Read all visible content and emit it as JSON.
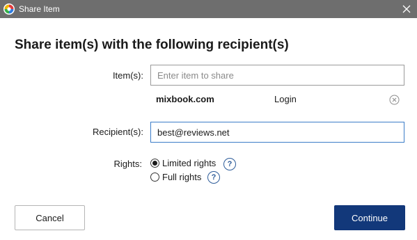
{
  "window": {
    "title": "Share Item",
    "icon": "app-logo-icon",
    "close_icon": "close-icon"
  },
  "heading": "Share item(s) with the following recipient(s)",
  "items_field": {
    "label": "Item(s):",
    "placeholder": "Enter item to share",
    "value": ""
  },
  "selected_item": {
    "name": "mixbook.com",
    "type": "Login",
    "remove_icon": "remove-circle-x-icon"
  },
  "recipients_field": {
    "label": "Recipient(s):",
    "value": "best@reviews.net"
  },
  "rights": {
    "label": "Rights:",
    "options": [
      {
        "label": "Limited rights",
        "selected": true,
        "help_icon": "help-icon"
      },
      {
        "label": "Full rights",
        "selected": false,
        "help_icon": "help-icon"
      }
    ],
    "help_glyph": "?"
  },
  "buttons": {
    "cancel": "Cancel",
    "continue": "Continue"
  },
  "colors": {
    "titlebar": "#6e6e6e",
    "primary": "#12387a",
    "focus_border": "#3b7cc8",
    "help": "#2c5b99"
  }
}
